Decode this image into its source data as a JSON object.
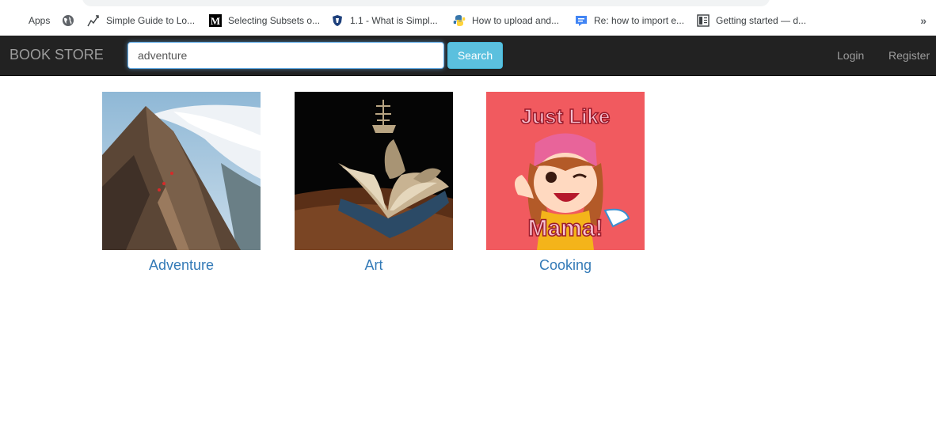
{
  "bookmarks": [
    {
      "label": "Apps",
      "icon": "apps-grid-icon"
    },
    {
      "label": "",
      "icon": "globe-icon"
    },
    {
      "label": "Simple Guide to Lo...",
      "icon": "trend-line-icon"
    },
    {
      "label": "Selecting Subsets o...",
      "icon": "medium-m-icon"
    },
    {
      "label": "1.1 - What is Simpl...",
      "icon": "shield-logo-icon"
    },
    {
      "label": "How to upload and...",
      "icon": "python-logo-icon"
    },
    {
      "label": "Re: how to import e...",
      "icon": "forum-logo-icon"
    },
    {
      "label": "Getting started — d...",
      "icon": "docs-page-icon"
    }
  ],
  "bookmarks_overflow": "»",
  "navbar": {
    "brand": "BOOK STORE",
    "search_value": "adventure",
    "search_button": "Search",
    "login": "Login",
    "register": "Register"
  },
  "categories": [
    {
      "label": "Adventure",
      "image": "mountain-ridge-image"
    },
    {
      "label": "Art",
      "image": "book-sculpture-image"
    },
    {
      "label": "Cooking",
      "image": "cooking-mama-image"
    }
  ],
  "cooking_logo": {
    "line1": "Just Like",
    "line2": "Mama!"
  },
  "colors": {
    "navbar_bg": "#222222",
    "navbar_text": "#9d9d9d",
    "search_button": "#5bc0de",
    "link": "#337ab7"
  }
}
